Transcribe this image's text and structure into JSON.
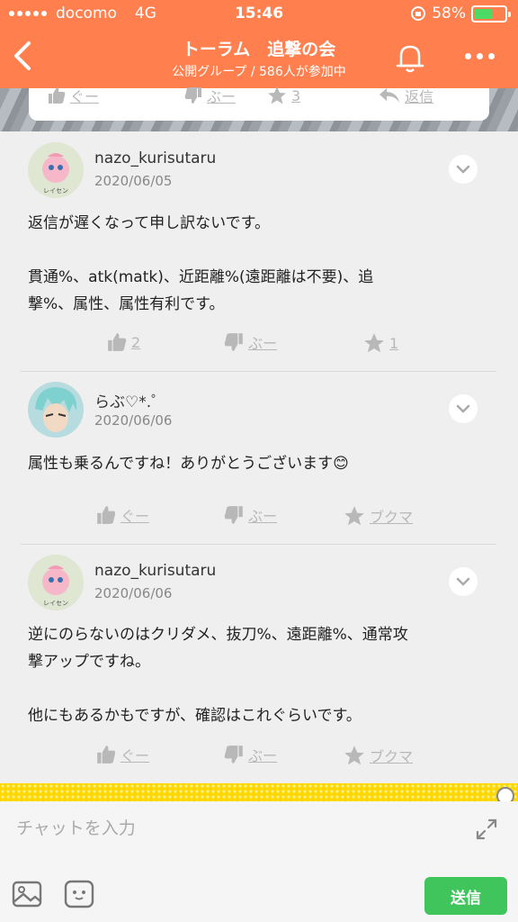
{
  "status_bar": {
    "carrier": "docomo",
    "network": "4G",
    "time": "15:46",
    "battery": "58%",
    "battery_level": 0.58
  },
  "header": {
    "title": "トーラム　追撃の会",
    "subtitle": "公開グループ / 586人が参加中"
  },
  "previous_post_actions": {
    "good_label": "ぐー",
    "boo_label": "ぶー",
    "star_count": "3",
    "reply_label": "返信"
  },
  "posts": [
    {
      "username": "nazo_kurisutaru",
      "date": "2020/06/05",
      "avatar_caption": "レイセン",
      "body_lines": [
        "返信が遅くなって申し訳ないです。",
        "",
        "貫通%、atk(matk)、近距離%(遠距離は不要)、追",
        "撃%、属性、属性有利です。"
      ],
      "good_label": "2",
      "boo_label": "ぶー",
      "star_label": "1"
    },
    {
      "username": "らぶ♡*.゜",
      "date": "2020/06/06",
      "body_lines": [
        "属性も乗るんですね！ありがとうございます😊"
      ],
      "good_label": "ぐー",
      "boo_label": "ぶー",
      "star_label": "ブクマ"
    },
    {
      "username": "nazo_kurisutaru",
      "date": "2020/06/06",
      "avatar_caption": "レイセン",
      "body_lines": [
        "逆にのらないのはクリダメ、抜刀%、遠距離%、通常攻",
        "撃アップですね。",
        "",
        "他にもあるかもですが、確認はこれぐらいです。"
      ],
      "good_label": "ぐー",
      "boo_label": "ぶー",
      "star_label": "ブクマ"
    }
  ],
  "composer": {
    "placeholder": "チャットを入力",
    "send_label": "送信"
  },
  "colors": {
    "header": "#ff7f4f",
    "send": "#3fc55c",
    "action": "#b8b8b8"
  }
}
